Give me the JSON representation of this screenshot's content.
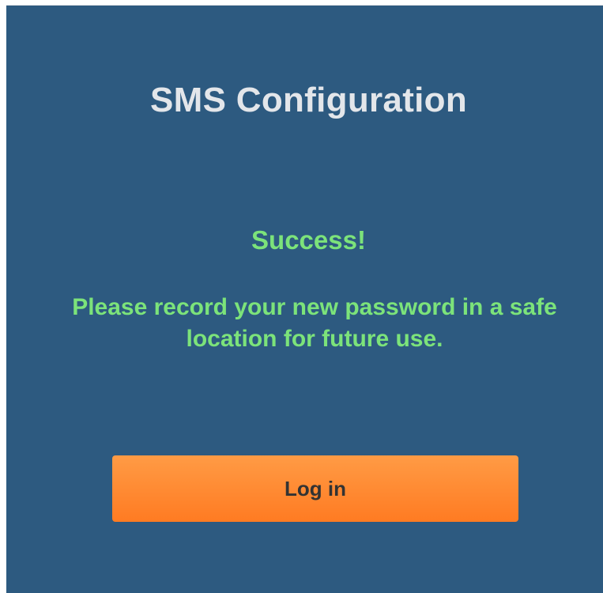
{
  "panel": {
    "title": "SMS Configuration",
    "status_heading": "Success!",
    "message": "Please record your new password in a safe location for future use.",
    "login_button_label": "Log in"
  },
  "colors": {
    "panel_background": "#2d5a80",
    "title_text": "#e3e6ea",
    "success_text": "#7ce37a",
    "button_top": "#ff9b45",
    "button_bottom": "#ff7b22",
    "button_text": "#333333"
  }
}
